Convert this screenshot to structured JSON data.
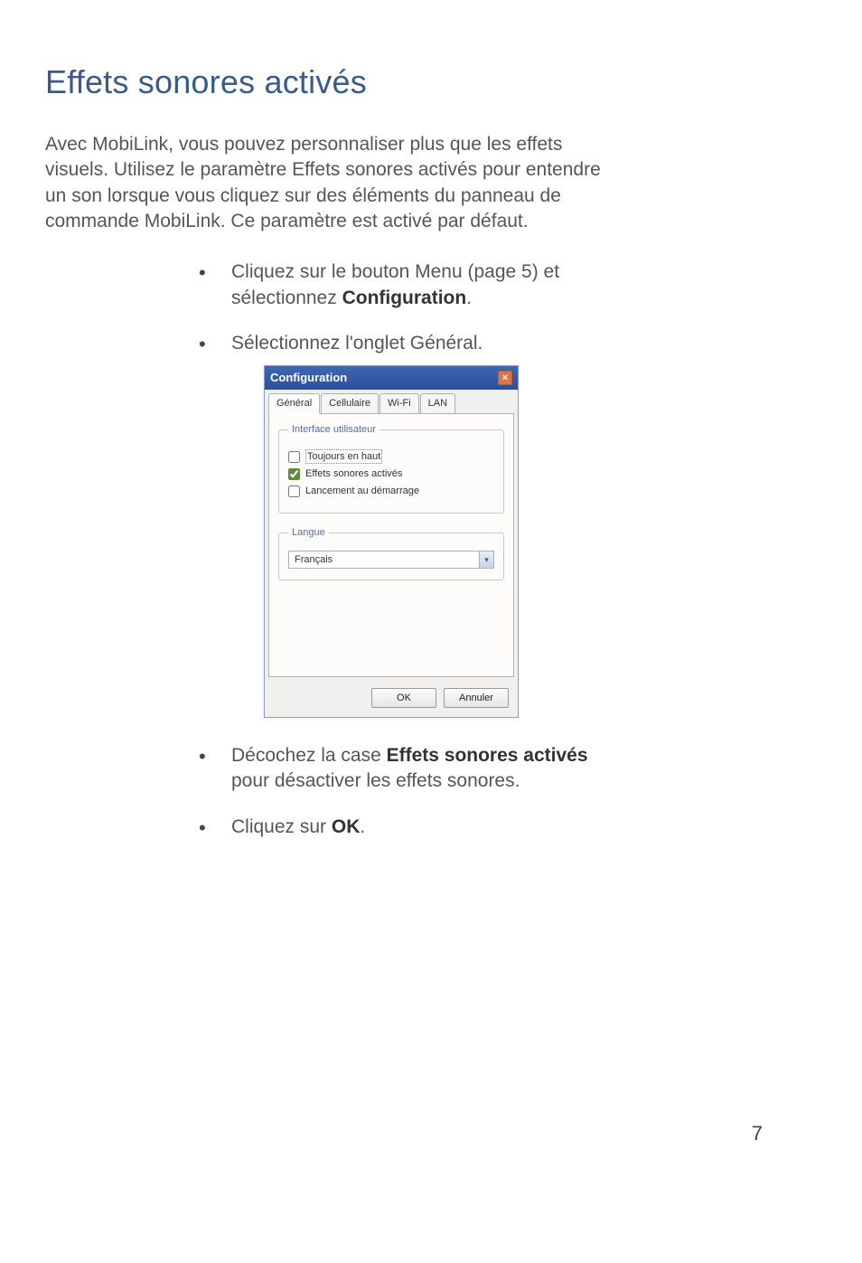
{
  "heading": "Effets sonores activés",
  "intro": "Avec MobiLink, vous pouvez personnaliser plus que les effets visuels. Utilisez le paramètre Effets sonores activés pour entendre un son lorsque vous cliquez sur des éléments du panneau de commande MobiLink. Ce paramètre est activé par défaut.",
  "steps": {
    "s1_a": "Cliquez sur le bouton Menu (page 5) et sélectionnez ",
    "s1_b": "Configuration",
    "s1_c": ".",
    "s2": "Sélectionnez l'onglet Général.",
    "s3_a": "Décochez la case ",
    "s3_b": "Effets sonores activés",
    "s3_c": " pour désactiver les effets sonores.",
    "s4_a": "Cliquez sur ",
    "s4_b": "OK",
    "s4_c": "."
  },
  "dialog": {
    "title": "Configuration",
    "close": "×",
    "tabs": {
      "general": "Général",
      "cellular": "Cellulaire",
      "wifi": "Wi-Fi",
      "lan": "LAN"
    },
    "group_ui_legend": "Interface utilisateur",
    "chk_always_top": "Toujours en haut",
    "chk_sound": "Effets sonores activés",
    "chk_launch": "Lancement au démarrage",
    "group_lang_legend": "Langue",
    "lang_value": "Français",
    "btn_ok": "OK",
    "btn_cancel": "Annuler"
  },
  "page_number": "7"
}
